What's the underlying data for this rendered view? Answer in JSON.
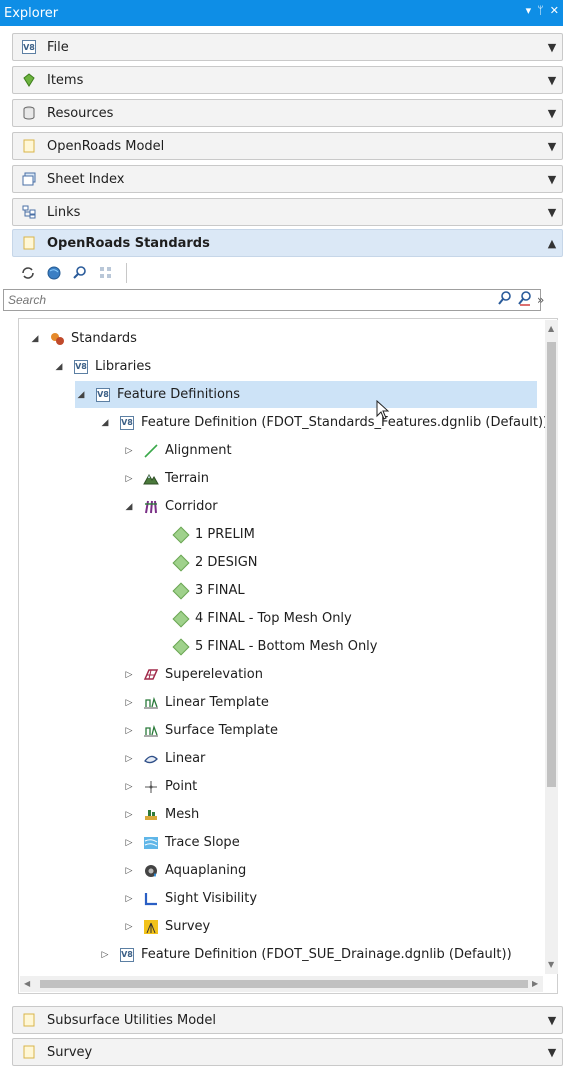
{
  "title": "Explorer",
  "title_controls": [
    "▾",
    "ᛘ",
    "✕"
  ],
  "panels_top": [
    {
      "label": "File"
    },
    {
      "label": "Items"
    },
    {
      "label": "Resources"
    },
    {
      "label": "OpenRoads Model"
    },
    {
      "label": "Sheet Index"
    },
    {
      "label": "Links"
    },
    {
      "label": "OpenRoads Standards"
    }
  ],
  "search": {
    "placeholder": "Search"
  },
  "tree": [
    {
      "label": "Standards"
    },
    {
      "label": "Libraries"
    },
    {
      "label": "Feature Definitions"
    },
    {
      "label": "Feature Definition (FDOT_Standards_Features.dgnlib (Default))"
    },
    {
      "label": "Alignment"
    },
    {
      "label": "Terrain"
    },
    {
      "label": "Corridor"
    },
    {
      "label": "1 PRELIM"
    },
    {
      "label": "2 DESIGN"
    },
    {
      "label": "3 FINAL"
    },
    {
      "label": "4 FINAL - Top Mesh Only"
    },
    {
      "label": "5 FINAL - Bottom Mesh Only"
    },
    {
      "label": "Superelevation"
    },
    {
      "label": "Linear Template"
    },
    {
      "label": "Surface Template"
    },
    {
      "label": "Linear"
    },
    {
      "label": "Point"
    },
    {
      "label": "Mesh"
    },
    {
      "label": "Trace Slope"
    },
    {
      "label": "Aquaplaning"
    },
    {
      "label": "Sight Visibility"
    },
    {
      "label": "Survey"
    },
    {
      "label": "Feature Definition (FDOT_SUE_Drainage.dgnlib (Default))"
    }
  ],
  "panels_bottom": [
    {
      "label": "Subsurface Utilities Model"
    },
    {
      "label": "Survey"
    }
  ],
  "colors": {
    "title_bar": "#0e8ee6",
    "selection": "#cde3f7",
    "active_panel": "#dbe8f6"
  }
}
